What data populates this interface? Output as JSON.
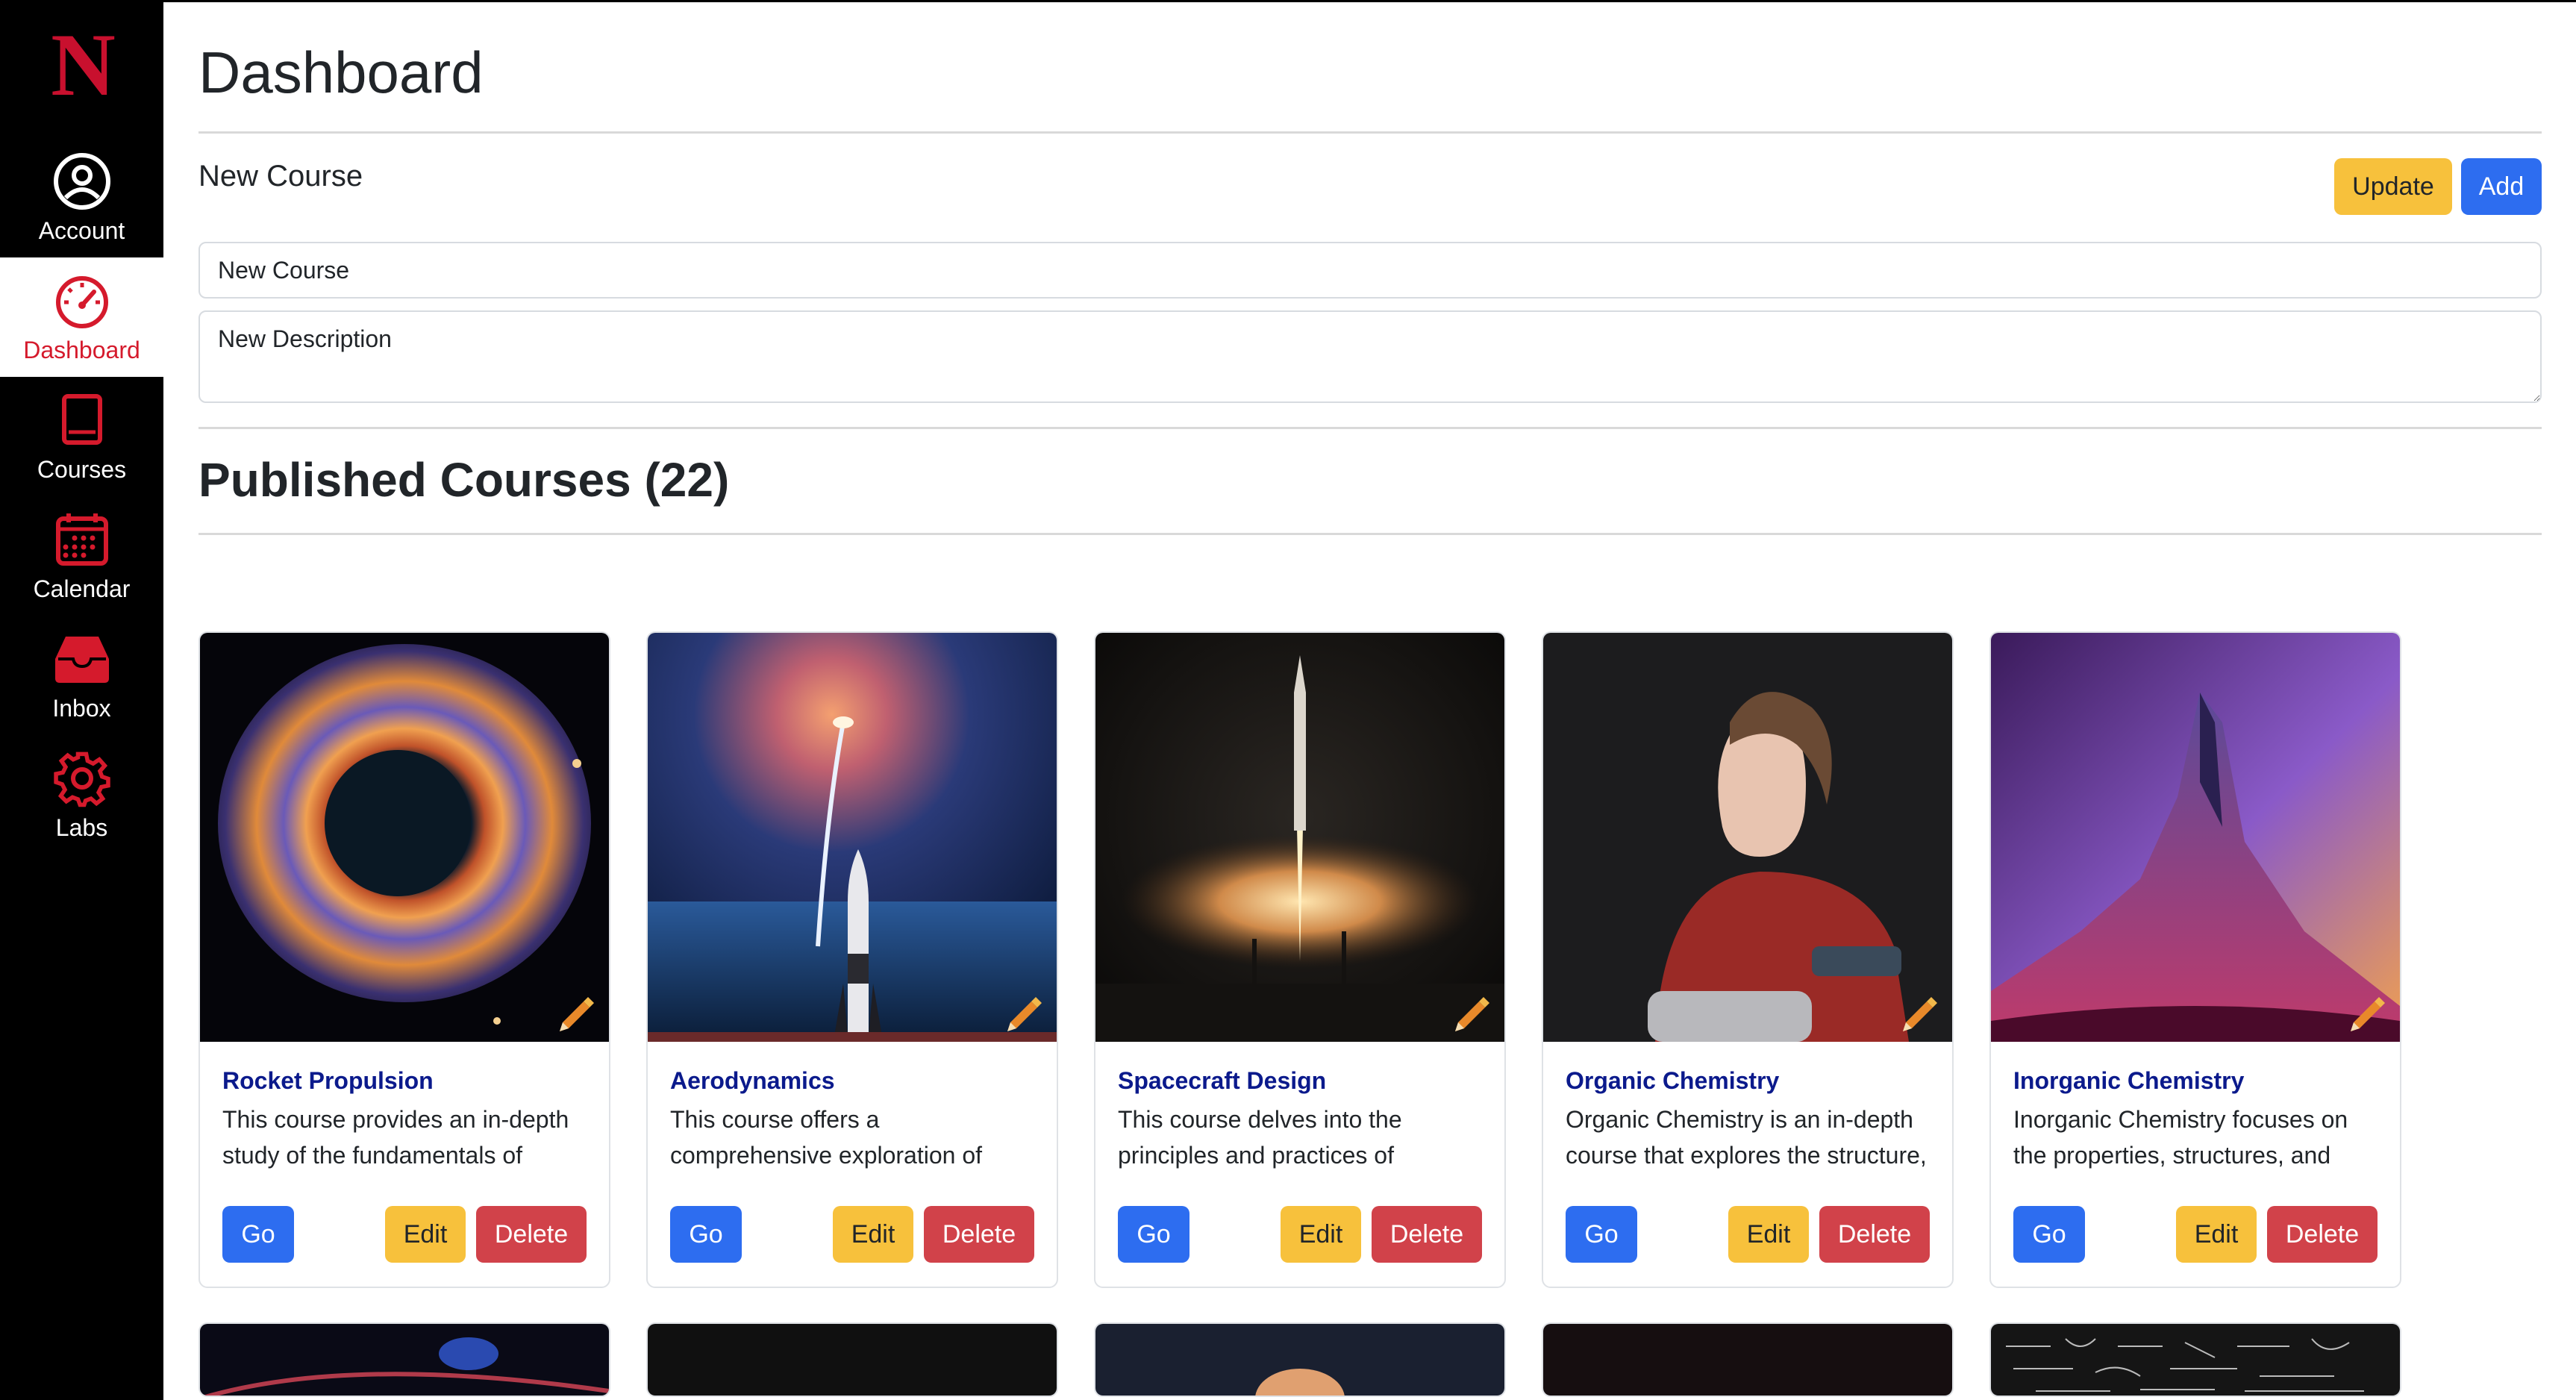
{
  "sidebar": {
    "logo_letter": "N",
    "items": [
      {
        "label": "Account",
        "icon": "account-circle-icon",
        "active": false
      },
      {
        "label": "Dashboard",
        "icon": "speedometer-icon",
        "active": true
      },
      {
        "label": "Courses",
        "icon": "book-icon",
        "active": false
      },
      {
        "label": "Calendar",
        "icon": "calendar-icon",
        "active": false
      },
      {
        "label": "Inbox",
        "icon": "inbox-icon",
        "active": false
      },
      {
        "label": "Labs",
        "icon": "gear-icon",
        "active": false
      }
    ],
    "accent_color": "#d51a2c"
  },
  "header": {
    "title": "Dashboard"
  },
  "course_form": {
    "title": "New Course",
    "update_label": "Update",
    "add_label": "Add",
    "name_value": "New Course",
    "description_value": "New Description"
  },
  "published": {
    "title": "Published Courses (22)"
  },
  "cards": [
    {
      "title": "Rocket Propulsion",
      "description": "This course provides an in-depth study of the fundamentals of",
      "image": "blackhole-image",
      "go": "Go",
      "edit": "Edit",
      "delete": "Delete"
    },
    {
      "title": "Aerodynamics",
      "description": "This course offers a comprehensive exploration of",
      "image": "rocket-ocean-image",
      "go": "Go",
      "edit": "Edit",
      "delete": "Delete"
    },
    {
      "title": "Spacecraft Design",
      "description": "This course delves into the principles and practices of",
      "image": "rocket-launch-image",
      "go": "Go",
      "edit": "Edit",
      "delete": "Delete"
    },
    {
      "title": "Organic Chemistry",
      "description": "Organic Chemistry is an in-depth course that explores the structure,",
      "image": "girl-portrait-image",
      "go": "Go",
      "edit": "Edit",
      "delete": "Delete"
    },
    {
      "title": "Inorganic Chemistry",
      "description": "Inorganic Chemistry focuses on the properties, structures, and",
      "image": "crystal-mountain-image",
      "go": "Go",
      "edit": "Edit",
      "delete": "Delete"
    }
  ],
  "colors": {
    "primary": "#2d6df0",
    "warning": "#f7c13c",
    "danger": "#d1424a",
    "card_title": "#0b1a8c"
  }
}
